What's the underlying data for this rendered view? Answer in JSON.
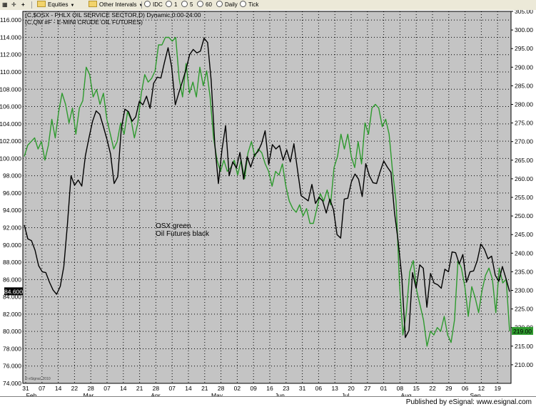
{
  "toolbar": {
    "icons": [
      "grid-icon",
      "crosshair-icon",
      "plus-icon"
    ],
    "equities_label": "Equities",
    "intervals_label": "Other Intervals",
    "idc_label": "IDC",
    "i1": "1",
    "i5": "5",
    "i60": "60",
    "daily_label": "Daily",
    "tick_label": "Tick"
  },
  "footer": {
    "text": "Published by eSignal: www.esignal.com"
  },
  "watermark": "© eSignal, 2010",
  "chart_data": {
    "type": "line",
    "title": "",
    "symbol_lines": [
      "(C,$OSX - PHLX OIL SERVICE SECTOR,D) Dynamic,0:00-24:00",
      "(C,QM #F - E-MINI CRUDE OIL FUTURES)"
    ],
    "annotation": [
      "OSX green",
      "Oil Futures black"
    ],
    "left_axis": {
      "min": 74,
      "max": 117,
      "ticks": [
        "116.000",
        "114.000",
        "112.000",
        "110.000",
        "108.000",
        "106.000",
        "104.000",
        "102.000",
        "100.000",
        "98.000",
        "96.000",
        "94.000",
        "92.000",
        "90.000",
        "88.000",
        "86.000",
        "84.000",
        "82.000",
        "80.000",
        "78.000",
        "76.000",
        "74.000"
      ]
    },
    "right_axis": {
      "min": 205,
      "max": 305,
      "ticks": [
        "305.00",
        "300.00",
        "295.00",
        "290.00",
        "285.00",
        "280.00",
        "275.00",
        "270.00",
        "265.00",
        "260.00",
        "255.00",
        "250.00",
        "245.00",
        "240.00",
        "235.00",
        "230.00",
        "225.00",
        "220.00",
        "215.00",
        "210.00"
      ]
    },
    "last_value_left": "84.600",
    "last_value_right": "219.00",
    "x_day_labels": [
      "31",
      "07",
      "14",
      "22",
      "28",
      "07",
      "14",
      "21",
      "28",
      "07",
      "14",
      "21",
      "28",
      "02",
      "09",
      "16",
      "23",
      "31",
      "06",
      "13",
      "20",
      "27",
      "01",
      "08",
      "15",
      "22",
      "29",
      "06",
      "12",
      "19"
    ],
    "x_month_labels": [
      "Feb",
      "Mar",
      "Apr",
      "May",
      "Jun",
      "Jul",
      "Aug",
      "Sep"
    ],
    "grid": true,
    "series": [
      {
        "name": "OSX green",
        "axis": "right",
        "color": "#2e9a2e",
        "values": [
          266,
          269,
          270,
          271,
          268,
          270,
          265,
          269,
          276,
          271,
          278,
          283,
          280,
          275,
          279,
          272,
          279,
          281,
          290,
          288,
          282,
          284,
          280,
          283,
          276,
          272,
          268,
          270,
          275,
          272,
          278,
          276,
          271,
          275,
          283,
          288,
          286,
          287,
          289,
          296,
          296,
          298,
          298,
          297,
          298,
          287,
          282,
          291,
          283,
          286,
          282,
          290,
          285,
          289,
          282,
          271,
          265,
          262,
          265,
          262,
          263,
          265,
          261,
          265,
          260,
          267,
          270,
          266,
          268,
          267,
          264,
          262,
          258,
          262,
          261,
          264,
          258,
          254,
          252,
          251,
          253,
          250,
          252,
          248,
          248,
          252,
          256,
          254,
          257,
          253,
          263,
          266,
          272,
          268,
          272,
          266,
          263,
          270,
          264,
          275,
          272,
          279,
          280,
          279,
          274,
          276,
          272,
          262,
          254,
          232,
          218,
          224,
          235,
          238,
          230,
          226,
          222,
          215,
          219,
          218,
          220,
          219,
          223,
          218,
          216,
          222,
          238,
          236,
          231,
          223,
          231,
          228,
          224,
          230,
          234,
          236,
          233,
          224,
          236,
          232,
          233,
          219
        ],
        "comment": "approximate daily closes from 31-Jan to 20-Sep"
      },
      {
        "name": "Oil Futures black",
        "axis": "left",
        "color": "#000000",
        "values": [
          92.3,
          90.7,
          90.5,
          89.4,
          87.6,
          86.9,
          86.8,
          85.7,
          84.8,
          84.3,
          85.2,
          87.5,
          92.3,
          98.0,
          96.9,
          97.5,
          96.8,
          100.3,
          102.4,
          104.3,
          105.5,
          105.1,
          103.7,
          102.2,
          100.5,
          97.1,
          97.9,
          103.5,
          105.7,
          105.4,
          104.3,
          104.8,
          106.6,
          106.2,
          107.2,
          105.8,
          108.7,
          109.4,
          109.3,
          111.1,
          112.8,
          110.6,
          106.2,
          107.6,
          108.9,
          110.3,
          112.0,
          112.6,
          112.2,
          112.4,
          113.9,
          113.4,
          109.0,
          101.6,
          97.1,
          101.0,
          103.8,
          98.0,
          99.6,
          98.9,
          100.7,
          97.6,
          100.2,
          99.0,
          100.4,
          100.8,
          101.7,
          103.2,
          99.3,
          101.6,
          101.1,
          101.5,
          99.8,
          101.0,
          99.6,
          101.7,
          98.7,
          95.7,
          95.4,
          95.1,
          97.0,
          94.8,
          95.5,
          95.1,
          93.7,
          95.3,
          94.1,
          91.2,
          90.8,
          95.3,
          95.4,
          97.3,
          98.2,
          97.6,
          95.6,
          99.4,
          98.0,
          97.2,
          97.1,
          98.5,
          99.7,
          99.0,
          98.4,
          93.7,
          90.4,
          86.4,
          79.3,
          80.1,
          86.8,
          85.0,
          87.7,
          87.3,
          82.8,
          86.7,
          85.6,
          85.4,
          85.0,
          87.2,
          86.9,
          89.2,
          89.1,
          87.8,
          88.9,
          85.7,
          86.9,
          87.0,
          88.2,
          90.1,
          89.5,
          88.4,
          88.7,
          86.5,
          85.8,
          87.5,
          86.1,
          84.6
        ],
        "comment": "approximate daily closes from 31-Jan to 20-Sep"
      }
    ]
  }
}
